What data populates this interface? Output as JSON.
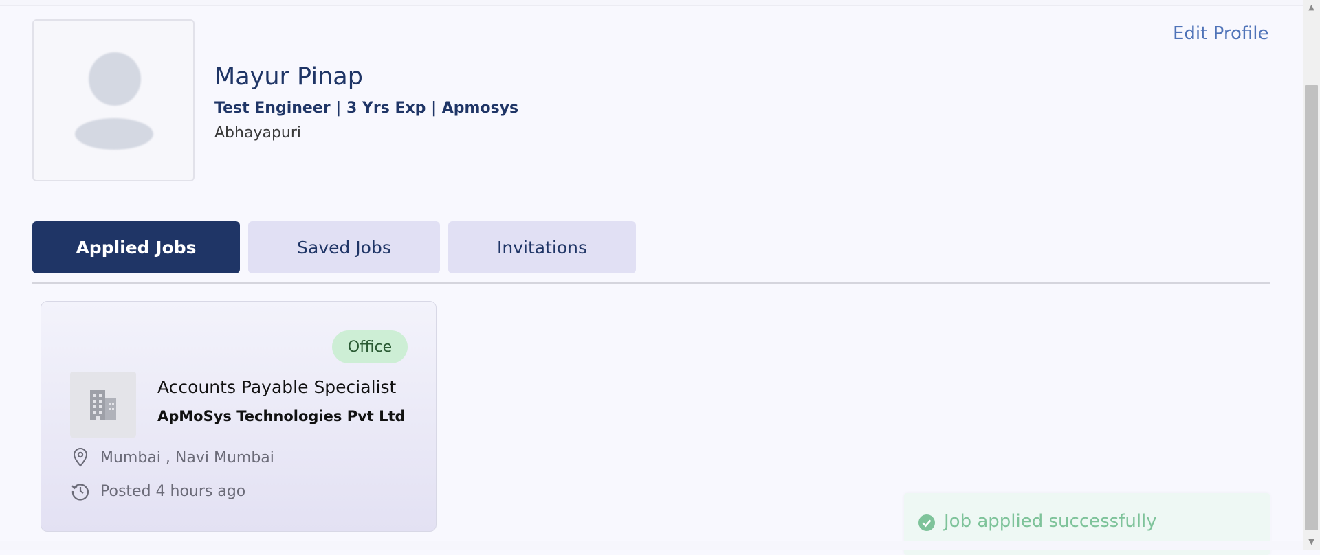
{
  "profile": {
    "name": "Mayur Pinap",
    "subtitle": "Test Engineer | 3 Yrs Exp | Apmosys",
    "location": "Abhayapuri",
    "edit_label": "Edit Profile"
  },
  "tabs": [
    {
      "label": "Applied Jobs",
      "active": true
    },
    {
      "label": "Saved Jobs",
      "active": false
    },
    {
      "label": "Invitations",
      "active": false
    }
  ],
  "job_card": {
    "badge": "Office",
    "title": "Accounts Payable Specialist",
    "company": "ApMoSys Technologies Pvt Ltd",
    "location": "Mumbai , Navi Mumbai",
    "posted": "Posted 4 hours ago",
    "icons": {
      "logo": "building-icon",
      "location": "map-pin-icon",
      "posted": "history-icon"
    }
  },
  "toast": {
    "message": "Job applied successfully",
    "icon": "check-circle-icon",
    "color": "#7ec39a"
  },
  "colors": {
    "primary": "#1f3566",
    "tab_inactive": "#e1e0f4",
    "link": "#4f73b8",
    "badge_bg": "#cdeed5"
  }
}
